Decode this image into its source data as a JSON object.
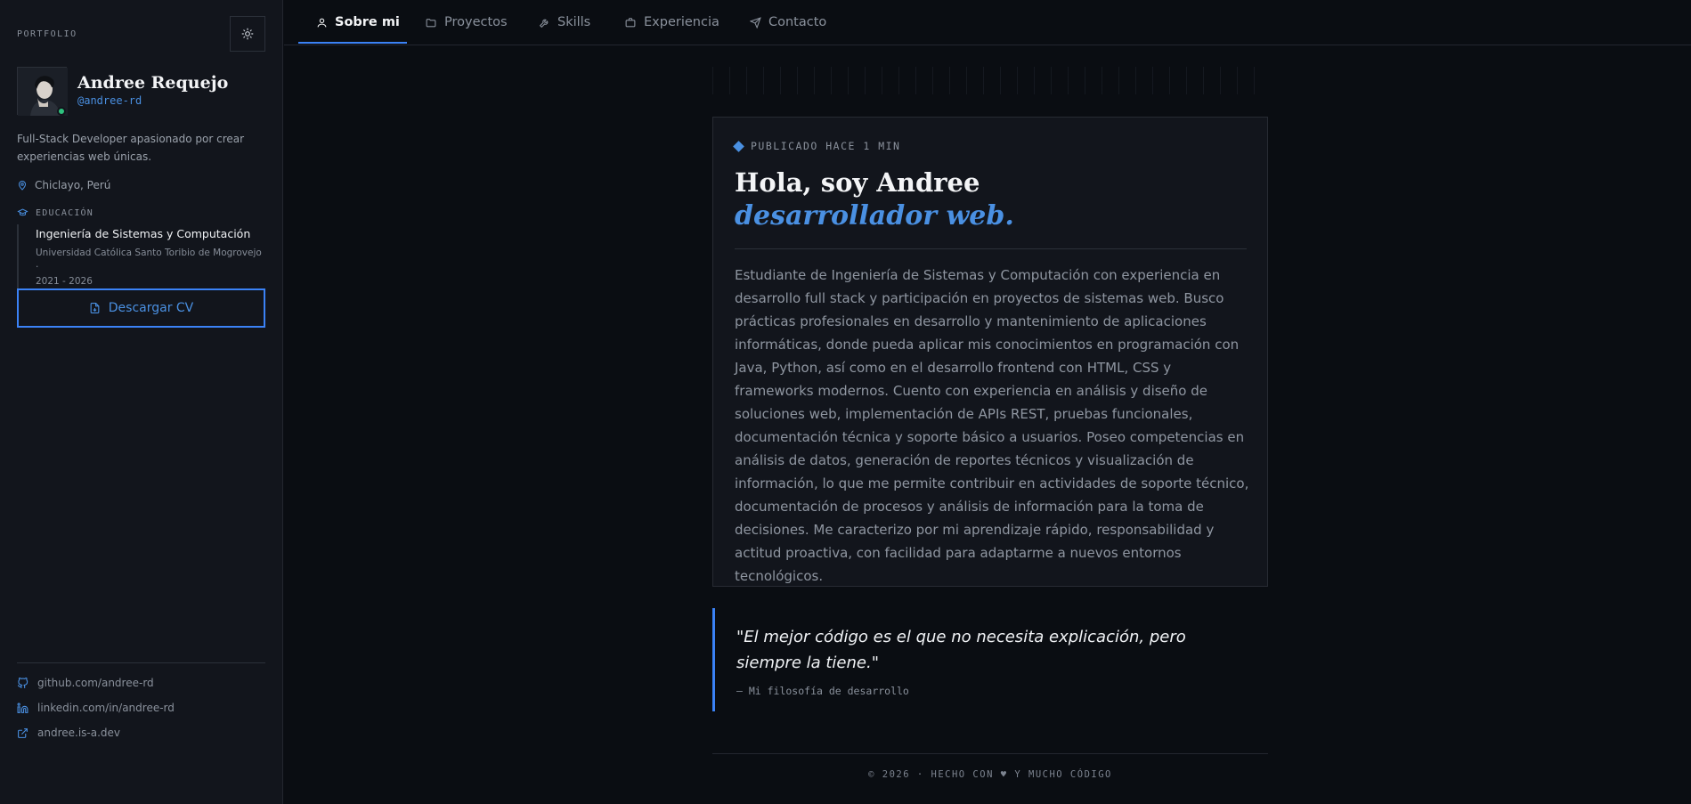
{
  "colors": {
    "accent": "#4a90e2",
    "accent_border": "#3b82f6",
    "status_online": "#2ec27e",
    "background": "#0a0d12",
    "sidebar_bg": "#12151c"
  },
  "sidebar": {
    "section_label": "PORTFOLIO",
    "theme_toggle_icon": "sun-icon",
    "profile": {
      "name": "Andree Requejo",
      "handle": "@andree-rd",
      "status": "online"
    },
    "bio": "Full-Stack Developer apasionado por crear experiencias web únicas.",
    "location": "Chiclayo, Perú",
    "education": {
      "label": "EDUCACIÓN",
      "degree": "Ingeniería de Sistemas y Computación",
      "institution": "Universidad Católica Santo Toribio de Mogrovejo ·",
      "years": "2021 - 2026"
    },
    "cv_button": "Descargar CV",
    "links": [
      {
        "icon": "github-icon",
        "label": "github.com/andree-rd"
      },
      {
        "icon": "linkedin-icon",
        "label": "linkedin.com/in/andree-rd"
      },
      {
        "icon": "external-link-icon",
        "label": "andree.is-a.dev"
      }
    ]
  },
  "nav": {
    "tabs": [
      {
        "label": "Sobre mi",
        "icon": "user-icon",
        "active": true
      },
      {
        "label": "Proyectos",
        "icon": "folder-icon",
        "active": false
      },
      {
        "label": "Skills",
        "icon": "wrench-icon",
        "active": false
      },
      {
        "label": "Experiencia",
        "icon": "briefcase-icon",
        "active": false
      },
      {
        "label": "Contacto",
        "icon": "send-icon",
        "active": false
      }
    ]
  },
  "main": {
    "published": "PUBLICADO HACE 1 MIN",
    "hero_line1": "Hola, soy Andree",
    "hero_line2": "desarrollador web.",
    "about": "Estudiante de Ingeniería de Sistemas y Computación con experiencia en desarrollo full stack y participación en proyectos de sistemas web. Busco prácticas profesionales en desarrollo y mantenimiento de aplicaciones informáticas, donde pueda aplicar mis conocimientos en programación con Java, Python, así como en el desarrollo frontend con HTML, CSS y frameworks modernos. Cuento con experiencia en análisis y diseño de soluciones web, implementación de APIs REST, pruebas funcionales, documentación técnica y soporte básico a usuarios. Poseo competencias en análisis de datos, generación de reportes técnicos y visualización de información, lo que me permite contribuir en actividades de soporte técnico, documentación de procesos y análisis de información para la toma de decisiones. Me caracterizo por mi aprendizaje rápido, responsabilidad y actitud proactiva, con facilidad para adaptarme a nuevos entornos tecnológicos."
  },
  "quote": {
    "text": "\"El mejor código es el que no necesita explicación, pero siempre la tiene.\"",
    "author": "— Mi filosofía de desarrollo"
  },
  "footer": {
    "text": "© 2026 · HECHO CON ♥ Y MUCHO CÓDIGO"
  }
}
